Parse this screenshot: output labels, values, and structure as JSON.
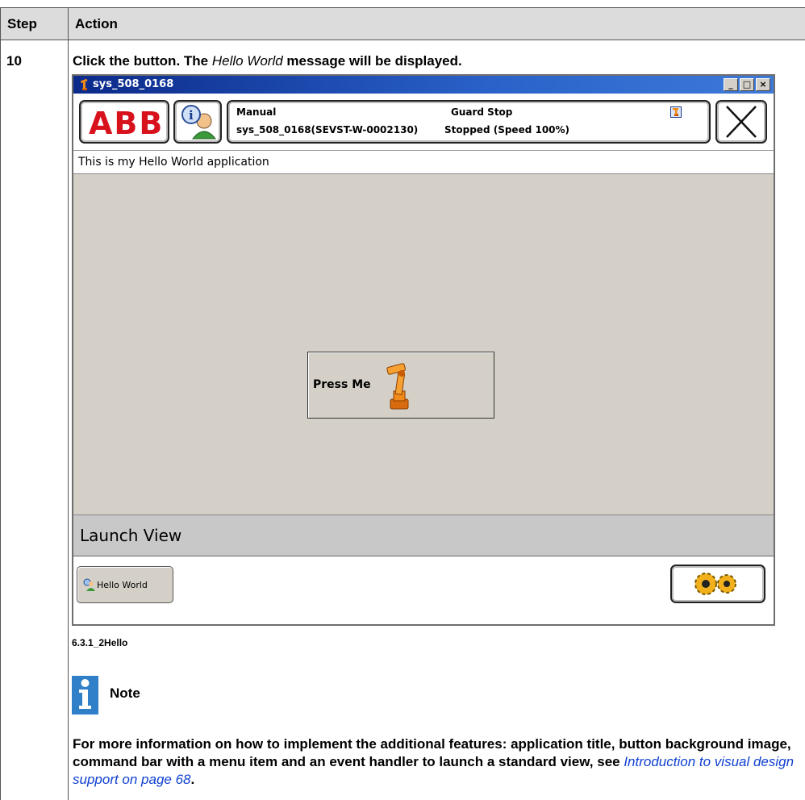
{
  "table": {
    "header_step": "Step",
    "header_action": "Action",
    "step_number": "10",
    "instruction_pre": "Click the button. The ",
    "instruction_italic": "Hello World",
    "instruction_post": " message will be displayed."
  },
  "window": {
    "title": "sys_508_0168",
    "minimize": "_",
    "maximize": "□",
    "close": "×"
  },
  "topbar": {
    "logo": "ABB",
    "mode": "Manual",
    "controller": "sys_508_0168(SEVST-W-0002130)",
    "state": "Guard Stop",
    "run_status": "Stopped (Speed 100%)"
  },
  "app": {
    "title": "This is my Hello World application",
    "press_button": "Press Me",
    "launch_view": "Launch View",
    "taskbar_item": "Hello World"
  },
  "figure_caption": "6.3.1_2Hello",
  "note": {
    "title": "Note",
    "text_pre": "For more information on how to implement the additional features: application title, button background image, command bar with a menu item and an event handler to launch a standard view, see ",
    "link": "Introduction to visual design support on page 68",
    "text_post": "."
  },
  "colors": {
    "abb_red": "#d8121d",
    "link_blue": "#1040d0",
    "note_icon": "#2f80c8",
    "title_bar": "#0b2a8a"
  }
}
